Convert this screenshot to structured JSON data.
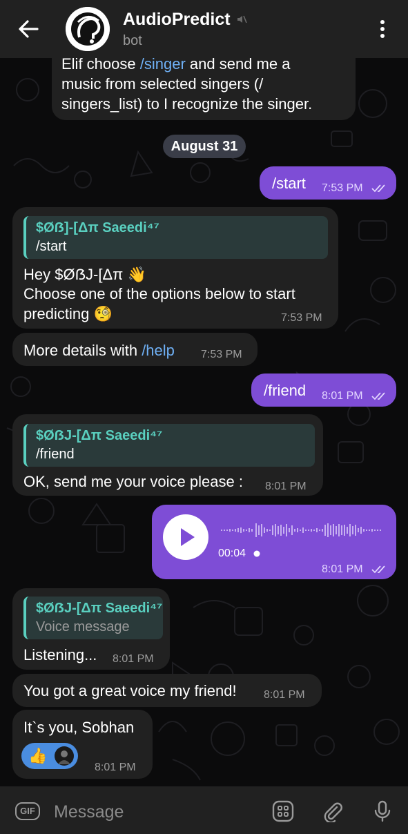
{
  "header": {
    "title": "AudioPredict",
    "subtitle": "bot"
  },
  "messages": {
    "top_info": {
      "line1_pre": "Elif choose ",
      "line1_link": "/singer",
      "line1_post": " and send me a",
      "line2": "music from selected singers (/",
      "line3": "singers_list) to I recognize the singer."
    },
    "date": "August 31",
    "start_cmd": {
      "text": "/start",
      "time": "7:53 PM"
    },
    "bot_greeting": {
      "reply_name": "$Øẞ]-[Δπ Saeedi⁴⁷",
      "reply_text": "/start",
      "line1": "Hey $ØẞJ-[Δπ 👋",
      "line2": "Choose one of the options below to start",
      "line3": "predicting 🧐",
      "time": "7:53 PM"
    },
    "more_details": {
      "text": "More details with ",
      "link": "/help",
      "time": "7:53 PM"
    },
    "friend_cmd": {
      "text": "/friend",
      "time": "8:01 PM"
    },
    "bot_send_voice": {
      "reply_name": "$ØẞJ-[Δπ Saeedi⁴⁷",
      "reply_text": "/friend",
      "text": "OK, send me your voice please :",
      "time": "8:01 PM"
    },
    "voice_msg": {
      "duration": "00:04",
      "time": "8:01 PM"
    },
    "bot_listening": {
      "reply_name": "$ØẞJ-[Δπ Saeedi⁴⁷",
      "reply_text": "Voice message",
      "text": "Listening...",
      "time": "8:01 PM"
    },
    "bot_compliment": {
      "text": "You got a great voice my friend!",
      "time": "8:01 PM"
    },
    "bot_result": {
      "text": "It`s you, Sobhan",
      "time": "8:01 PM",
      "reaction_count_icon": "thumbs-up"
    }
  },
  "composer": {
    "gif_label": "GIF",
    "placeholder": "Message"
  },
  "colors": {
    "outgoing": "#7e4dd6",
    "incoming": "#212121",
    "link": "#6fb0f5",
    "reply_accent": "#5ad0c0",
    "header": "#212121"
  }
}
